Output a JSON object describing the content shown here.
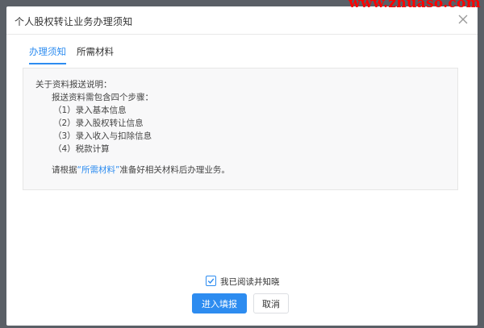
{
  "dialog": {
    "title": "个人股权转让业务办理须知",
    "watermark": "www.zhuaso.com"
  },
  "tabs": [
    {
      "label": "办理须知",
      "active": true
    },
    {
      "label": "所需材料",
      "active": false
    }
  ],
  "notice": {
    "heading": "关于资料报送说明：",
    "intro": "报送资料需包含四个步骤：",
    "steps": [
      "（1）录入基本信息",
      "（2）录入股权转让信息",
      "（3）录入收入与扣除信息",
      "（4）税款计算"
    ],
    "footer_prefix": "请根据",
    "footer_link": "“所需材料”",
    "footer_suffix": "准备好相关材料后办理业务。"
  },
  "agree": {
    "label": "我已阅读并知晓",
    "checked": true
  },
  "buttons": {
    "primary": "进入填报",
    "cancel": "取消"
  },
  "colors": {
    "accent": "#2d8cf0",
    "overlay": "#5a5f66",
    "watermark": "#ff0000"
  },
  "icons": {
    "close": "close-icon",
    "check": "check-icon"
  }
}
